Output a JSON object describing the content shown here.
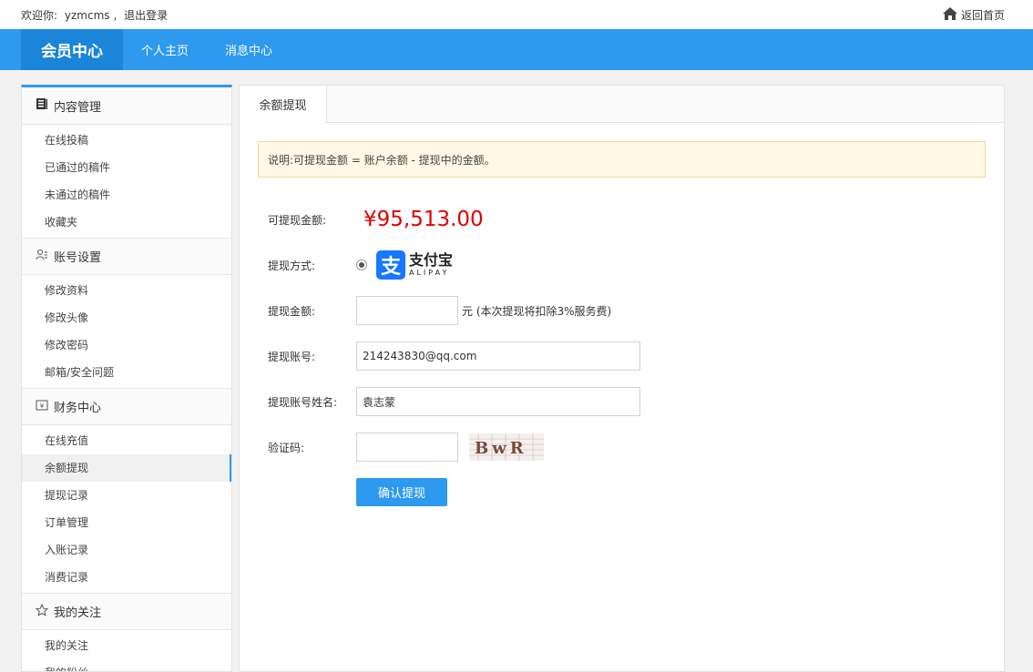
{
  "topbar": {
    "welcome_prefix": "欢迎你:",
    "username": "yzmcms",
    "separator": ",",
    "logout": "退出登录",
    "home_link": "返回首页"
  },
  "nav": {
    "brand": "会员中心",
    "items": [
      "个人主页",
      "消息中心"
    ]
  },
  "sidebar": {
    "groups": [
      {
        "title": "内容管理",
        "icon": "document-icon",
        "items": [
          "在线投稿",
          "已通过的稿件",
          "未通过的稿件",
          "收藏夹"
        ]
      },
      {
        "title": "账号设置",
        "icon": "user-list-icon",
        "items": [
          "修改资料",
          "修改头像",
          "修改密码",
          "邮箱/安全问题"
        ]
      },
      {
        "title": "财务中心",
        "icon": "wallet-icon",
        "items": [
          "在线充值",
          "余额提现",
          "提现记录",
          "订单管理",
          "入账记录",
          "消费记录"
        ]
      },
      {
        "title": "我的关注",
        "icon": "star-icon",
        "items": [
          "我的关注",
          "我的粉丝"
        ]
      }
    ],
    "active_item": "余额提现"
  },
  "content": {
    "tab": "余额提现",
    "notice": "说明:可提现金额 = 账户余额 - 提现中的金额。",
    "form": {
      "available_label": "可提现金额:",
      "available_amount": "¥95,513.00",
      "method_label": "提现方式:",
      "method_name_cn": "支付宝",
      "method_name_en": "ALIPAY",
      "amount_label": "提现金额:",
      "amount_value": "",
      "amount_unit": "元 (本次提现将扣除3%服务费)",
      "account_label": "提现账号:",
      "account_value": "214243830@qq.com",
      "account_name_label": "提现账号姓名:",
      "account_name_value": "袁志蒙",
      "captcha_label": "验证码:",
      "captcha_value": "",
      "captcha_text": "BwR",
      "submit_label": "确认提现"
    }
  },
  "colors": {
    "primary": "#2d9af0",
    "brand_bg": "#1a85d9",
    "amount": "#e10000",
    "notice_bg": "#fff8e6",
    "notice_border": "#f4d39b"
  }
}
